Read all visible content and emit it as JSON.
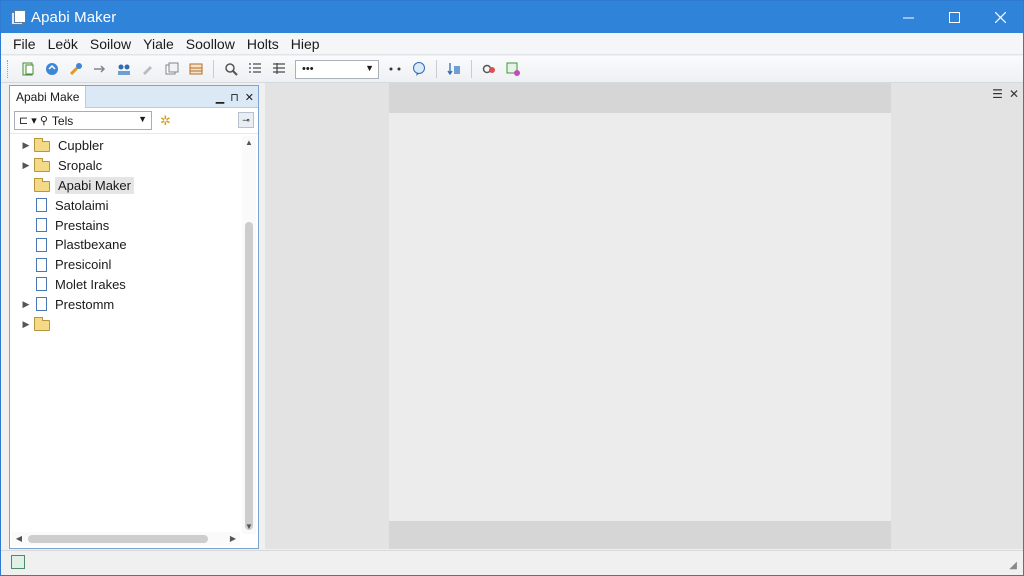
{
  "window": {
    "title": "Apabi Maker"
  },
  "menu": [
    "File",
    "Leök",
    "Soilow",
    "Yiale",
    "Soollow",
    "Holts",
    "Hiep"
  ],
  "toolbar": {
    "buttons": [
      "new-doc-icon",
      "open-icon",
      "brush-icon",
      "arrow-right-icon",
      "users-icon",
      "tag-icon",
      "copy-icon",
      "table-icon",
      "zoom-icon",
      "list-icon",
      "list-alt-icon"
    ],
    "combo_value": "•••",
    "extra_buttons": [
      "dots-icon",
      "comment-icon",
      "sort-icon",
      "link-icon",
      "export-icon"
    ]
  },
  "panel": {
    "title": "Apabi Make",
    "filter_value": "Tels",
    "items": [
      {
        "label": "Cupbler",
        "icon": "folder",
        "expandable": true
      },
      {
        "label": "Sropalc",
        "icon": "folder",
        "expandable": true
      },
      {
        "label": "Apabi Maker",
        "icon": "folder",
        "expandable": false,
        "selected": true
      },
      {
        "label": "Satolaimi",
        "icon": "doc",
        "expandable": false
      },
      {
        "label": "Prestains",
        "icon": "doc",
        "expandable": false
      },
      {
        "label": "Plastbexane",
        "icon": "doc",
        "expandable": false
      },
      {
        "label": "Presicoinl",
        "icon": "doc",
        "expandable": false
      },
      {
        "label": "Molet Irakes",
        "icon": "doc",
        "expandable": false
      },
      {
        "label": "Prestomm",
        "icon": "doc",
        "expandable": true
      },
      {
        "label": "",
        "icon": "folder",
        "expandable": true
      }
    ]
  }
}
